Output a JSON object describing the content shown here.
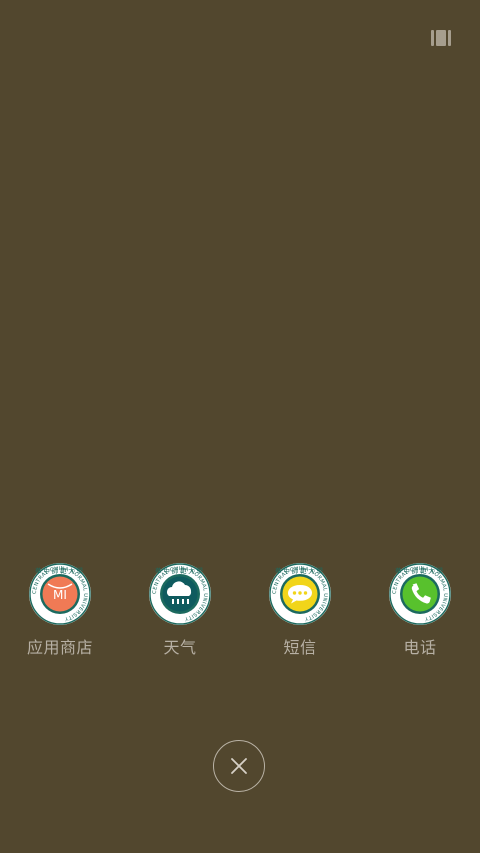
{
  "apps": [
    {
      "label": "应用商店",
      "badge": "MI",
      "inner_color": "#f07a55",
      "icon": "mi-store-icon"
    },
    {
      "label": "天气",
      "inner_color": "#0f5b5f",
      "icon": "weather-cloud-rain-icon"
    },
    {
      "label": "短信",
      "inner_color": "#f1d51a",
      "icon": "message-bubble-icon"
    },
    {
      "label": "电话",
      "inner_color": "#58c12d",
      "icon": "phone-handset-icon"
    }
  ],
  "ring_text": "CENTRAL CHINA NORMAL UNIVERSITY",
  "colors": {
    "background": "#52472e",
    "label": "#b7b0a4",
    "seal_ring": "#1c6a5f"
  }
}
